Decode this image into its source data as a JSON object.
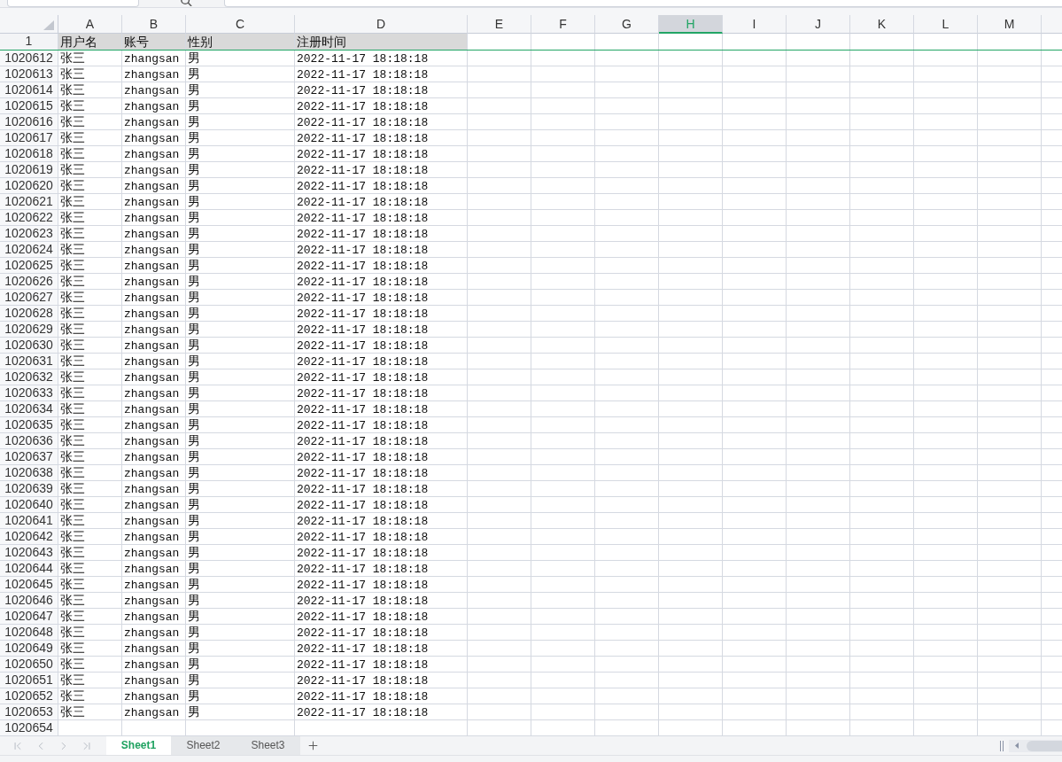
{
  "columns": [
    {
      "label": "A",
      "selected": false
    },
    {
      "label": "B",
      "selected": false
    },
    {
      "label": "C",
      "selected": false
    },
    {
      "label": "D",
      "selected": false
    },
    {
      "label": "E",
      "selected": false
    },
    {
      "label": "F",
      "selected": false
    },
    {
      "label": "G",
      "selected": false
    },
    {
      "label": "H",
      "selected": true
    },
    {
      "label": "I",
      "selected": false
    },
    {
      "label": "J",
      "selected": false
    },
    {
      "label": "K",
      "selected": false
    },
    {
      "label": "L",
      "selected": false
    },
    {
      "label": "M",
      "selected": false
    }
  ],
  "header_row": {
    "number": "1",
    "cells": [
      "用户名",
      "账号",
      "性别",
      "注册时间"
    ]
  },
  "rows": [
    {
      "number": "1020612",
      "cells": [
        "张三",
        "zhangsan",
        "男",
        "2022-11-17 18:18:18"
      ]
    },
    {
      "number": "1020613",
      "cells": [
        "张三",
        "zhangsan",
        "男",
        "2022-11-17 18:18:18"
      ]
    },
    {
      "number": "1020614",
      "cells": [
        "张三",
        "zhangsan",
        "男",
        "2022-11-17 18:18:18"
      ]
    },
    {
      "number": "1020615",
      "cells": [
        "张三",
        "zhangsan",
        "男",
        "2022-11-17 18:18:18"
      ]
    },
    {
      "number": "1020616",
      "cells": [
        "张三",
        "zhangsan",
        "男",
        "2022-11-17 18:18:18"
      ]
    },
    {
      "number": "1020617",
      "cells": [
        "张三",
        "zhangsan",
        "男",
        "2022-11-17 18:18:18"
      ]
    },
    {
      "number": "1020618",
      "cells": [
        "张三",
        "zhangsan",
        "男",
        "2022-11-17 18:18:18"
      ]
    },
    {
      "number": "1020619",
      "cells": [
        "张三",
        "zhangsan",
        "男",
        "2022-11-17 18:18:18"
      ]
    },
    {
      "number": "1020620",
      "cells": [
        "张三",
        "zhangsan",
        "男",
        "2022-11-17 18:18:18"
      ]
    },
    {
      "number": "1020621",
      "cells": [
        "张三",
        "zhangsan",
        "男",
        "2022-11-17 18:18:18"
      ]
    },
    {
      "number": "1020622",
      "cells": [
        "张三",
        "zhangsan",
        "男",
        "2022-11-17 18:18:18"
      ]
    },
    {
      "number": "1020623",
      "cells": [
        "张三",
        "zhangsan",
        "男",
        "2022-11-17 18:18:18"
      ]
    },
    {
      "number": "1020624",
      "cells": [
        "张三",
        "zhangsan",
        "男",
        "2022-11-17 18:18:18"
      ]
    },
    {
      "number": "1020625",
      "cells": [
        "张三",
        "zhangsan",
        "男",
        "2022-11-17 18:18:18"
      ]
    },
    {
      "number": "1020626",
      "cells": [
        "张三",
        "zhangsan",
        "男",
        "2022-11-17 18:18:18"
      ]
    },
    {
      "number": "1020627",
      "cells": [
        "张三",
        "zhangsan",
        "男",
        "2022-11-17 18:18:18"
      ]
    },
    {
      "number": "1020628",
      "cells": [
        "张三",
        "zhangsan",
        "男",
        "2022-11-17 18:18:18"
      ]
    },
    {
      "number": "1020629",
      "cells": [
        "张三",
        "zhangsan",
        "男",
        "2022-11-17 18:18:18"
      ]
    },
    {
      "number": "1020630",
      "cells": [
        "张三",
        "zhangsan",
        "男",
        "2022-11-17 18:18:18"
      ]
    },
    {
      "number": "1020631",
      "cells": [
        "张三",
        "zhangsan",
        "男",
        "2022-11-17 18:18:18"
      ]
    },
    {
      "number": "1020632",
      "cells": [
        "张三",
        "zhangsan",
        "男",
        "2022-11-17 18:18:18"
      ]
    },
    {
      "number": "1020633",
      "cells": [
        "张三",
        "zhangsan",
        "男",
        "2022-11-17 18:18:18"
      ]
    },
    {
      "number": "1020634",
      "cells": [
        "张三",
        "zhangsan",
        "男",
        "2022-11-17 18:18:18"
      ]
    },
    {
      "number": "1020635",
      "cells": [
        "张三",
        "zhangsan",
        "男",
        "2022-11-17 18:18:18"
      ]
    },
    {
      "number": "1020636",
      "cells": [
        "张三",
        "zhangsan",
        "男",
        "2022-11-17 18:18:18"
      ]
    },
    {
      "number": "1020637",
      "cells": [
        "张三",
        "zhangsan",
        "男",
        "2022-11-17 18:18:18"
      ]
    },
    {
      "number": "1020638",
      "cells": [
        "张三",
        "zhangsan",
        "男",
        "2022-11-17 18:18:18"
      ]
    },
    {
      "number": "1020639",
      "cells": [
        "张三",
        "zhangsan",
        "男",
        "2022-11-17 18:18:18"
      ]
    },
    {
      "number": "1020640",
      "cells": [
        "张三",
        "zhangsan",
        "男",
        "2022-11-17 18:18:18"
      ]
    },
    {
      "number": "1020641",
      "cells": [
        "张三",
        "zhangsan",
        "男",
        "2022-11-17 18:18:18"
      ]
    },
    {
      "number": "1020642",
      "cells": [
        "张三",
        "zhangsan",
        "男",
        "2022-11-17 18:18:18"
      ]
    },
    {
      "number": "1020643",
      "cells": [
        "张三",
        "zhangsan",
        "男",
        "2022-11-17 18:18:18"
      ]
    },
    {
      "number": "1020644",
      "cells": [
        "张三",
        "zhangsan",
        "男",
        "2022-11-17 18:18:18"
      ]
    },
    {
      "number": "1020645",
      "cells": [
        "张三",
        "zhangsan",
        "男",
        "2022-11-17 18:18:18"
      ]
    },
    {
      "number": "1020646",
      "cells": [
        "张三",
        "zhangsan",
        "男",
        "2022-11-17 18:18:18"
      ]
    },
    {
      "number": "1020647",
      "cells": [
        "张三",
        "zhangsan",
        "男",
        "2022-11-17 18:18:18"
      ]
    },
    {
      "number": "1020648",
      "cells": [
        "张三",
        "zhangsan",
        "男",
        "2022-11-17 18:18:18"
      ]
    },
    {
      "number": "1020649",
      "cells": [
        "张三",
        "zhangsan",
        "男",
        "2022-11-17 18:18:18"
      ]
    },
    {
      "number": "1020650",
      "cells": [
        "张三",
        "zhangsan",
        "男",
        "2022-11-17 18:18:18"
      ]
    },
    {
      "number": "1020651",
      "cells": [
        "张三",
        "zhangsan",
        "男",
        "2022-11-17 18:18:18"
      ]
    },
    {
      "number": "1020652",
      "cells": [
        "张三",
        "zhangsan",
        "男",
        "2022-11-17 18:18:18"
      ]
    },
    {
      "number": "1020653",
      "cells": [
        "张三",
        "zhangsan",
        "男",
        "2022-11-17 18:18:18"
      ]
    },
    {
      "number": "1020654"
    }
  ],
  "sheet_tabs": [
    {
      "label": "Sheet1",
      "selected": true
    },
    {
      "label": "Sheet2",
      "selected": false
    },
    {
      "label": "Sheet3",
      "selected": false
    }
  ]
}
